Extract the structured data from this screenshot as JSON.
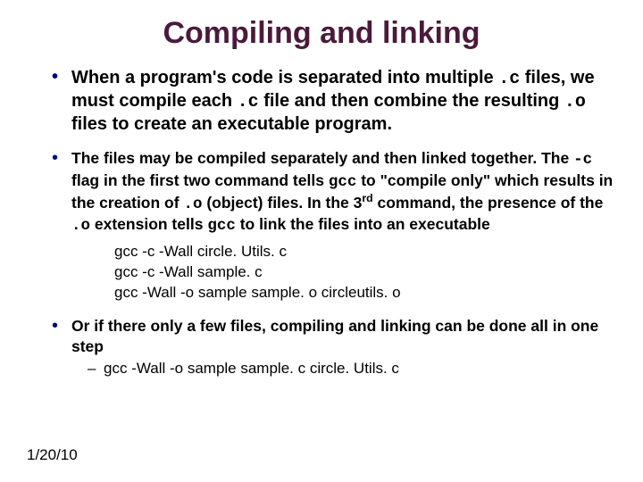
{
  "title": "Compiling and linking",
  "bullets": {
    "b1_pre": "When a program's code is separated into multiple ",
    "b1_code1": ".c",
    "b1_mid1": " files, we must compile each ",
    "b1_code2": ".c",
    "b1_mid2": " file and then combine the resulting ",
    "b1_code3": ".o",
    "b1_post": " files to create an executable program.",
    "b2_pre": "The files may be compiled separately and then linked together.  The ",
    "b2_code1": "-c",
    "b2_mid1": " flag in the first two command tells ",
    "b2_code2": "gcc",
    "b2_mid2": " to \"compile only\" which results in the creation of ",
    "b2_code3": ".o",
    "b2_mid3": " (object) files.  In the 3",
    "b2_sup": "rd",
    "b2_mid4": " command, the presence of the ",
    "b2_code4": ".o",
    "b2_mid5": " extension tells ",
    "b2_code5": "gcc",
    "b2_post": " to link the files into an executable",
    "cmd1": "gcc -c -Wall circle. Utils. c",
    "cmd2": "gcc -c -Wall sample. c",
    "cmd3": "gcc -Wall  -o sample sample. o circleutils. o",
    "b3": "Or if there only a few files, compiling and linking can be done all in one step",
    "sub1": "gcc -Wall -o sample sample. c circle. Utils. c"
  },
  "date": "1/20/10"
}
